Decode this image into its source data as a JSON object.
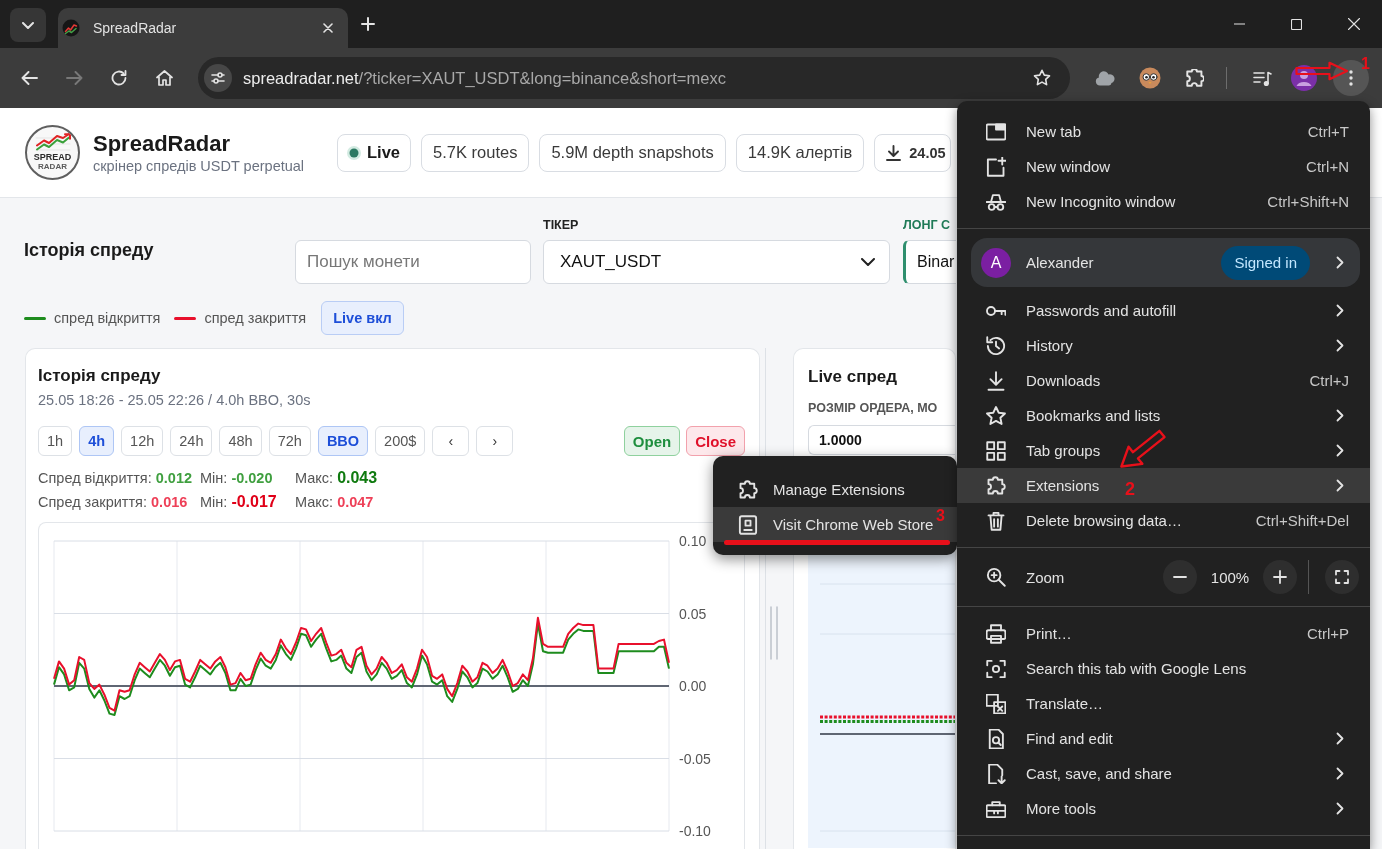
{
  "browser": {
    "tabs": [
      {
        "title": "SpreadRadar",
        "selected": true
      }
    ],
    "forward": {
      "disabled": true
    },
    "address": {
      "host": "spreadradar.net",
      "path": "/?ticker=XAUT_USDT&long=binance&short=mexc"
    }
  },
  "page": {
    "header": {
      "logo": {
        "word": "SPREAD",
        "subword": "RADAR"
      },
      "title": "SpreadRadar",
      "subtitle": "скрінер спредів USDT perpetual",
      "chips": [
        {
          "kind": "status",
          "label": "Live"
        },
        {
          "kind": "stat",
          "label": "5.7K routes"
        },
        {
          "kind": "stat",
          "label": "5.9M depth snapshots"
        },
        {
          "kind": "stat",
          "label": "14.9K алертів"
        },
        {
          "kind": "download",
          "label": "24.05"
        }
      ]
    },
    "filters": {
      "title": "Історія спреду",
      "search": {
        "placeholder": "Пошук монети"
      },
      "selects": [
        {
          "kind": "plain",
          "label": "ТІКЕР",
          "value": "XAUT_USDT"
        },
        {
          "kind": "long",
          "label": "ЛОНГ С",
          "value": "Binar"
        }
      ]
    },
    "live_toggle": {
      "label": "Live вкл",
      "on": true
    },
    "history": {
      "title": "Історія спреду",
      "subtitle": "25.05 18:26 - 25.05 22:26 / 4.0h BBO, 30s",
      "ranges": [
        {
          "label": "1h",
          "selected": false
        },
        {
          "label": "4h",
          "selected": true
        },
        {
          "label": "12h",
          "selected": false
        },
        {
          "label": "24h",
          "selected": false
        },
        {
          "label": "48h",
          "selected": false
        },
        {
          "label": "72h",
          "selected": false
        }
      ],
      "modes": [
        {
          "label": "BBO",
          "selected": true
        },
        {
          "label": "200$",
          "selected": false
        }
      ],
      "pager": [
        "‹",
        "›"
      ],
      "toggles": [
        {
          "kind": "open",
          "label": "Open",
          "on": true
        },
        {
          "kind": "close",
          "label": "Close",
          "on": true
        }
      ],
      "stats": [
        {
          "kind": "open",
          "cells": [
            {
              "label": "Спред відкриття:",
              "value": "0.012",
              "emphasis": false
            },
            {
              "label": "Мін:",
              "value": "-0.020",
              "emphasis": false
            },
            {
              "label": "Макс:",
              "value": "0.043",
              "emphasis": true
            }
          ]
        },
        {
          "kind": "close",
          "cells": [
            {
              "label": "Спред закриття:",
              "value": "0.016",
              "emphasis": false
            },
            {
              "label": "Мін:",
              "value": "-0.017",
              "emphasis": true
            },
            {
              "label": "Макс:",
              "value": "0.047",
              "emphasis": false
            }
          ]
        }
      ],
      "chart_data": {
        "type": "line",
        "grid": true,
        "series": [
          {
            "name": "спред відкриття",
            "color": "#1e8c1e",
            "values": [
              0.001,
              0.013,
              0.008,
              -0.003,
              -0.001,
              0.016,
              0.012,
              -0.002,
              -0.008,
              -0.003,
              -0.01,
              -0.019,
              -0.02,
              -0.007,
              -0.009,
              -0.007,
              0.004,
              0.012,
              0.009,
              0.006,
              0.012,
              0.018,
              0.014,
              0.007,
              0.013,
              0.014,
              0.001,
              -0.001,
              0.006,
              0.014,
              0.011,
              0.008,
              0.013,
              0.016,
              0.009,
              -0.003,
              -0.003,
              0.005,
              0.0,
              0.001,
              0.011,
              0.019,
              0.014,
              0.012,
              0.018,
              0.028,
              0.022,
              0.018,
              0.026,
              0.036,
              0.035,
              0.027,
              0.032,
              0.036,
              0.026,
              0.017,
              0.018,
              0.021,
              0.012,
              0.009,
              0.02,
              0.023,
              0.01,
              0.004,
              0.008,
              0.016,
              0.012,
              0.005,
              0.007,
              0.011,
              0.002,
              -0.001,
              0.008,
              0.021,
              0.015,
              0.003,
              0.001,
              0.004,
              -0.007,
              -0.011,
              -0.002,
              0.01,
              0.006,
              -0.001,
              0.002,
              0.012,
              0.01,
              0.005,
              0.008,
              0.014,
              0.006,
              -0.004,
              -0.002,
              0.004,
              0.0,
              0.015,
              0.043,
              0.024,
              0.023,
              0.023,
              0.023,
              0.023,
              0.032,
              0.036,
              0.039,
              0.038,
              0.038,
              0.038,
              0.009,
              0.009,
              0.009,
              0.009,
              0.024,
              0.024,
              0.024,
              0.024,
              0.024,
              0.024,
              0.024,
              0.024,
              0.027,
              0.027,
              0.012
            ]
          },
          {
            "name": "спред закриття",
            "color": "#e8102c",
            "values": [
              0.005,
              0.017,
              0.012,
              0.001,
              0.004,
              0.02,
              0.018,
              0.002,
              -0.002,
              0.001,
              -0.006,
              -0.015,
              -0.017,
              -0.003,
              -0.004,
              -0.003,
              0.008,
              0.016,
              0.013,
              0.01,
              0.016,
              0.022,
              0.018,
              0.011,
              0.017,
              0.018,
              0.005,
              0.003,
              0.01,
              0.018,
              0.015,
              0.012,
              0.017,
              0.02,
              0.013,
              0.001,
              0.002,
              0.009,
              0.004,
              0.005,
              0.015,
              0.023,
              0.018,
              0.016,
              0.022,
              0.032,
              0.026,
              0.022,
              0.03,
              0.04,
              0.039,
              0.031,
              0.036,
              0.04,
              0.03,
              0.021,
              0.022,
              0.025,
              0.016,
              0.013,
              0.025,
              0.027,
              0.014,
              0.008,
              0.012,
              0.02,
              0.016,
              0.009,
              0.011,
              0.015,
              0.006,
              0.003,
              0.012,
              0.025,
              0.02,
              0.007,
              0.005,
              0.008,
              -0.002,
              -0.007,
              0.002,
              0.014,
              0.01,
              0.003,
              0.006,
              0.016,
              0.014,
              0.009,
              0.012,
              0.018,
              0.01,
              0.0,
              0.002,
              0.008,
              0.004,
              0.019,
              0.047,
              0.029,
              0.027,
              0.027,
              0.027,
              0.027,
              0.036,
              0.04,
              0.043,
              0.042,
              0.042,
              0.042,
              0.012,
              0.012,
              0.012,
              0.012,
              0.029,
              0.029,
              0.029,
              0.029,
              0.029,
              0.029,
              0.029,
              0.029,
              0.031,
              0.032,
              0.016
            ]
          }
        ],
        "ylim": [
          -0.1,
          0.1
        ],
        "yticks": [
          {
            "value": -0.1,
            "label": "-0.10"
          },
          {
            "value": -0.05,
            "label": "-0.05"
          },
          {
            "value": 0,
            "label": "0.00"
          },
          {
            "value": 0.05,
            "label": "0.05"
          },
          {
            "value": 0.1,
            "label": "0.10"
          }
        ]
      }
    },
    "live": {
      "title": "Live спред",
      "order_size": {
        "label": "РОЗМІР ОРДЕРА, МО",
        "value": "1.0000"
      }
    }
  },
  "menu": {
    "sections": [
      {
        "kind": "items",
        "items": [
          {
            "label": "New tab",
            "shortcut": "Ctrl+T",
            "submenu": false,
            "highlighted": false
          },
          {
            "label": "New window",
            "shortcut": "Ctrl+N",
            "submenu": false,
            "highlighted": false
          },
          {
            "label": "New Incognito window",
            "shortcut": "Ctrl+Shift+N",
            "submenu": false,
            "highlighted": false
          }
        ]
      },
      {
        "kind": "profile",
        "initial": "A",
        "name": "Alexander",
        "badge": "Signed in"
      },
      {
        "kind": "items",
        "items": [
          {
            "label": "Passwords and autofill",
            "submenu": true,
            "highlighted": false
          },
          {
            "label": "History",
            "submenu": true,
            "highlighted": false
          },
          {
            "label": "Downloads",
            "shortcut": "Ctrl+J",
            "submenu": false,
            "highlighted": false
          },
          {
            "label": "Bookmarks and lists",
            "submenu": true,
            "highlighted": false
          },
          {
            "label": "Tab groups",
            "submenu": true,
            "highlighted": false
          },
          {
            "label": "Extensions",
            "submenu": true,
            "highlighted": true
          },
          {
            "label": "Delete browsing data…",
            "shortcut": "Ctrl+Shift+Del",
            "submenu": false,
            "highlighted": false
          }
        ]
      },
      {
        "kind": "zoom",
        "label": "Zoom",
        "value": "100%"
      },
      {
        "kind": "items",
        "items": [
          {
            "label": "Print…",
            "shortcut": "Ctrl+P",
            "submenu": false,
            "highlighted": false
          },
          {
            "label": "Search this tab with Google Lens",
            "submenu": false,
            "highlighted": false
          },
          {
            "label": "Translate…",
            "submenu": false,
            "highlighted": false
          },
          {
            "label": "Find and edit",
            "submenu": true,
            "highlighted": false
          },
          {
            "label": "Cast, save, and share",
            "submenu": true,
            "highlighted": false
          },
          {
            "label": "More tools",
            "submenu": true,
            "highlighted": false
          }
        ]
      }
    ]
  },
  "extensions_submenu": {
    "items": [
      {
        "label": "Manage Extensions",
        "highlighted": false
      },
      {
        "label": "Visit Chrome Web Store",
        "highlighted": true
      }
    ]
  },
  "annotations": [
    {
      "kind": "arrow",
      "number": "1"
    },
    {
      "kind": "outline-arrow",
      "number": "2"
    },
    {
      "kind": "underline",
      "number": "3"
    }
  ]
}
